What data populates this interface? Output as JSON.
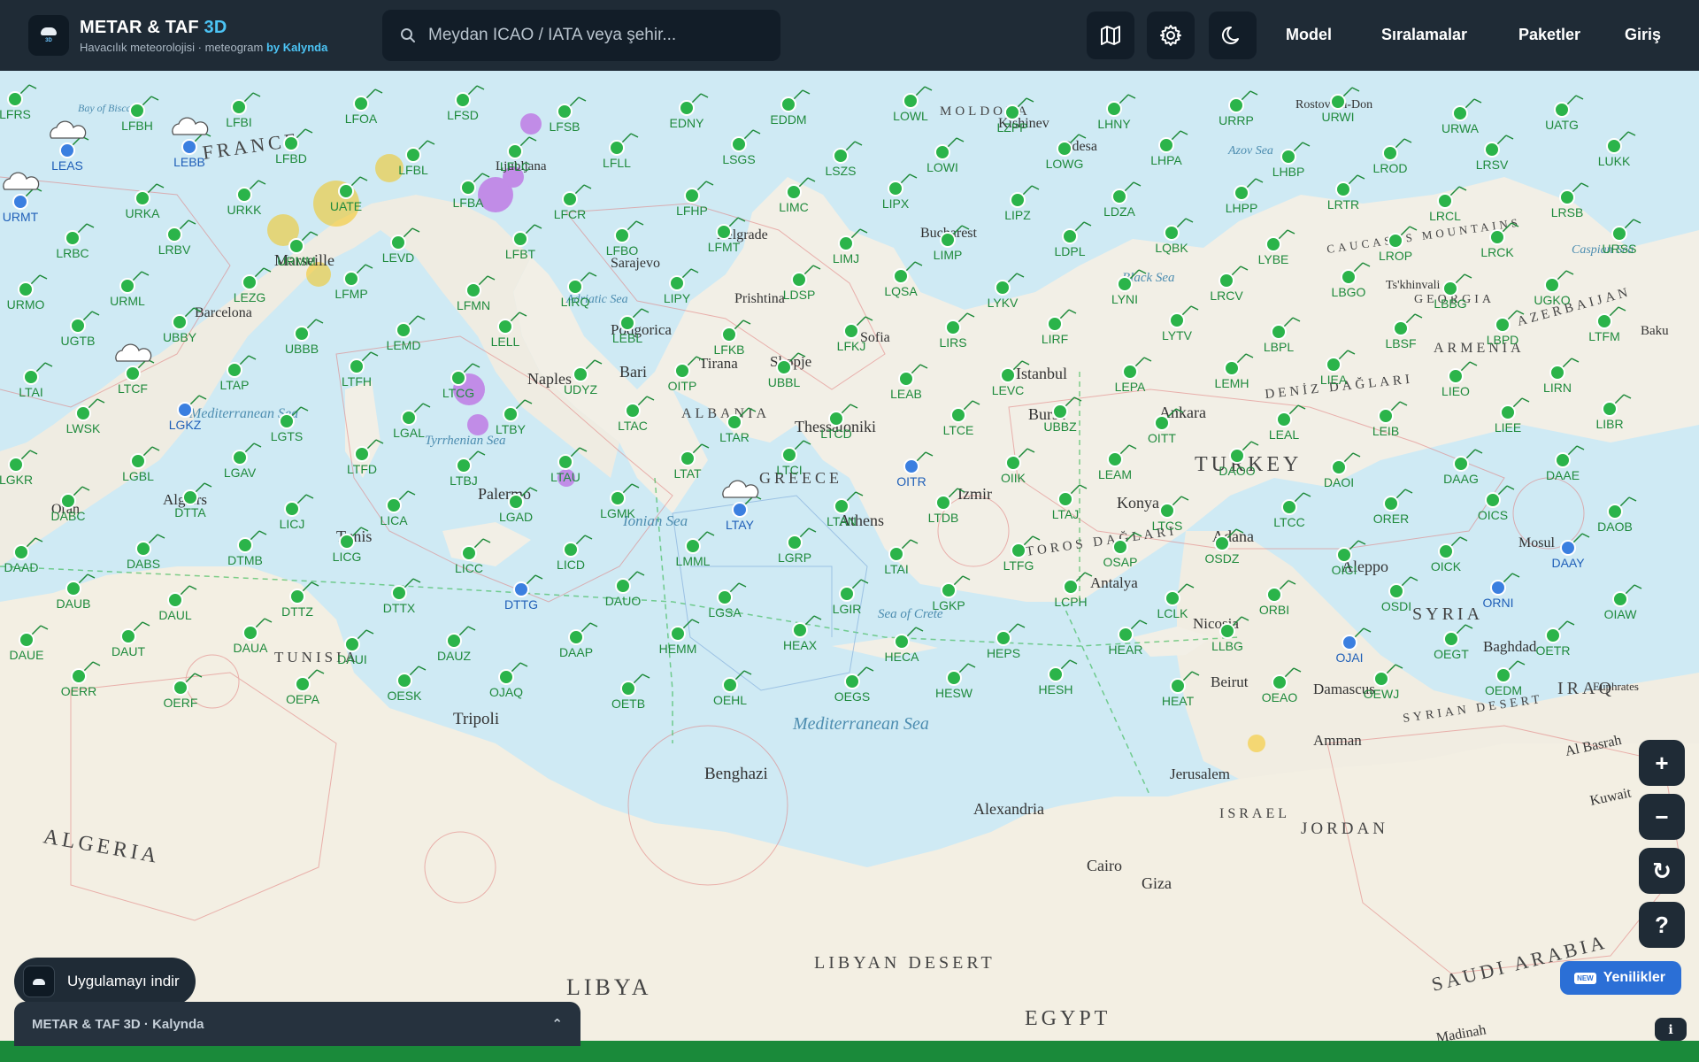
{
  "header": {
    "title_main": "METAR & TAF",
    "title_accent": "3D",
    "subtitle": "Havacılık meteorolojisi · meteogram",
    "subtitle_by": "by Kalynda",
    "logo_text": "3D"
  },
  "search": {
    "placeholder": "Meydan ICAO / IATA veya şehir..."
  },
  "nav": {
    "model": "Model",
    "rankings": "Sıralamalar",
    "packages": "Paketler",
    "login": "Giriş"
  },
  "icons": {
    "layers": "map-icon",
    "settings": "gear-icon",
    "theme": "moon-icon",
    "search": "search-icon"
  },
  "colors": {
    "header_bg": "#1f2b36",
    "accent": "#4cc4f5",
    "station_green": "#2bb44a",
    "station_blue": "#3b7fe0",
    "news_blue": "#2b6fd6",
    "footer_green": "#1a8a3a"
  },
  "map": {
    "places": [
      {
        "name": "FRANCE"
      },
      {
        "name": "Marseille"
      },
      {
        "name": "Barcelona"
      },
      {
        "name": "Ljubljana"
      },
      {
        "name": "Sarajevo"
      },
      {
        "name": "Belgrade"
      },
      {
        "name": "Prishtina"
      },
      {
        "name": "Podgorica"
      },
      {
        "name": "Skopje"
      },
      {
        "name": "Tirana"
      },
      {
        "name": "ALBANIA"
      },
      {
        "name": "Sofia"
      },
      {
        "name": "Bucharest"
      },
      {
        "name": "MOLDOVA"
      },
      {
        "name": "Kishinev"
      },
      {
        "name": "Odesa"
      },
      {
        "name": "Rostov-on-Don"
      },
      {
        "name": "Istanbul"
      },
      {
        "name": "Bursa"
      },
      {
        "name": "Ankara"
      },
      {
        "name": "TURKEY"
      },
      {
        "name": "Izmir"
      },
      {
        "name": "Konya"
      },
      {
        "name": "Adana"
      },
      {
        "name": "Antalya"
      },
      {
        "name": "Aleppo"
      },
      {
        "name": "Mosul"
      },
      {
        "name": "SYRIA"
      },
      {
        "name": "Baghdad"
      },
      {
        "name": "IRAQ"
      },
      {
        "name": "Damascus"
      },
      {
        "name": "Beirut"
      },
      {
        "name": "Nicosia"
      },
      {
        "name": "Amman"
      },
      {
        "name": "Jerusalem"
      },
      {
        "name": "ISRAEL"
      },
      {
        "name": "JORDAN"
      },
      {
        "name": "Cairo"
      },
      {
        "name": "Giza"
      },
      {
        "name": "EGYPT"
      },
      {
        "name": "Alexandria"
      },
      {
        "name": "Benghazi"
      },
      {
        "name": "Tripoli"
      },
      {
        "name": "LIBYA"
      },
      {
        "name": "TUNISIA"
      },
      {
        "name": "Tunis"
      },
      {
        "name": "Algiers"
      },
      {
        "name": "ALGERIA"
      },
      {
        "name": "Oran"
      },
      {
        "name": "Palermo"
      },
      {
        "name": "Naples"
      },
      {
        "name": "Bari"
      },
      {
        "name": "Athens"
      },
      {
        "name": "Thessaloniki"
      },
      {
        "name": "GREECE"
      },
      {
        "name": "Ts'khinvali"
      },
      {
        "name": "GEORGIA"
      },
      {
        "name": "ARMENIA"
      },
      {
        "name": "AZERBAIJAN"
      },
      {
        "name": "Baku"
      },
      {
        "name": "CAUCASUS MOUNTAINS"
      },
      {
        "name": "TOROS DAĞLARI"
      },
      {
        "name": "DENİZ DAĞLARI"
      },
      {
        "name": "SYRIAN DESERT"
      },
      {
        "name": "Al Basrah"
      },
      {
        "name": "Kuwait"
      },
      {
        "name": "SAUDI ARABIA"
      },
      {
        "name": "Madinah"
      },
      {
        "name": "Euphrates"
      },
      {
        "name": "LIBYAN DESERT"
      }
    ],
    "seas": [
      {
        "name": "Mediterranean Sea"
      },
      {
        "name": "Black Sea"
      },
      {
        "name": "Azov Sea"
      },
      {
        "name": "Caspian Sea"
      },
      {
        "name": "Ionian Sea"
      },
      {
        "name": "Tyrrhenian Sea"
      },
      {
        "name": "Adriatic Sea"
      },
      {
        "name": "Sea of Crete"
      },
      {
        "name": "Bay of Biscay"
      },
      {
        "name": "Mediterranean Sea (west)"
      }
    ],
    "stations": [
      "LFRS",
      "LFBH",
      "LFBI",
      "LFOA",
      "LFSD",
      "LFSB",
      "EDNY",
      "EDDM",
      "LOWL",
      "LZPP",
      "LHNY",
      "URRP",
      "URWI",
      "URWA",
      "UATG",
      "LEAS",
      "LEBB",
      "LFBD",
      "LFBL",
      "LFLC",
      "LFLL",
      "LSGS",
      "LSZS",
      "LOWI",
      "LOWG",
      "LHPA",
      "LHBP",
      "LROD",
      "LRSV",
      "LUKK",
      "URMT",
      "URKA",
      "URKK",
      "UATE",
      "LFBA",
      "LFCR",
      "LFHP",
      "LIMC",
      "LIPX",
      "LIPZ",
      "LDZA",
      "LHPP",
      "LRTR",
      "LRCL",
      "LRSB",
      "LRBC",
      "LRBV",
      "URMM",
      "LEVD",
      "LFBT",
      "LFBO",
      "LFMT",
      "LIMJ",
      "LIMP",
      "LDPL",
      "LQBK",
      "LYBE",
      "LROP",
      "LRCK",
      "URSS",
      "URMO",
      "URML",
      "LEZG",
      "LFMP",
      "LFMN",
      "LIRQ",
      "LIPY",
      "LDSP",
      "LQSA",
      "LYKV",
      "LYNI",
      "LRCV",
      "LBGO",
      "LBBG",
      "UGKO",
      "UGTB",
      "UBBY",
      "UBBB",
      "LEMD",
      "LELL",
      "LEBL",
      "LFKB",
      "LFKJ",
      "LIRS",
      "LIRF",
      "LYTV",
      "LBPL",
      "LBSF",
      "LBPD",
      "LTFM",
      "LTAI",
      "LTCF",
      "LTAP",
      "LTFH",
      "LTCG",
      "UDYZ",
      "OITP",
      "UBBL",
      "LEAB",
      "LEVC",
      "LEPA",
      "LEMH",
      "LIEA",
      "LIEO",
      "LIRN",
      "LWSK",
      "LGKZ",
      "LGTS",
      "LGAL",
      "LTBY",
      "LTAC",
      "LTAR",
      "LTCD",
      "LTCE",
      "UBBZ",
      "OITT",
      "LEAL",
      "LEIB",
      "LIEE",
      "LIBR",
      "LGKR",
      "LGBL",
      "LGAV",
      "LTFD",
      "LTBJ",
      "LTAU",
      "LTAT",
      "LTCI",
      "OITR",
      "OIIK",
      "LEAM",
      "DAOO",
      "DAOI",
      "DAAG",
      "DAAE",
      "DABC",
      "DTTA",
      "LICJ",
      "LICA",
      "LGAD",
      "LGMK",
      "LTAY",
      "LTAN",
      "LTDB",
      "LTAJ",
      "LTCS",
      "LTCC",
      "ORER",
      "OICS",
      "DAOB",
      "DAAD",
      "DABS",
      "DTMB",
      "LICG",
      "LICC",
      "LICD",
      "LMML",
      "LGRP",
      "LTAI",
      "LTFG",
      "OSAP",
      "OSDZ",
      "OICI",
      "OICK",
      "DAAY",
      "DAUB",
      "DAUL",
      "DTTZ",
      "DTTX",
      "DTTG",
      "DAUO",
      "LGSA",
      "LGIR",
      "LGKP",
      "LCPH",
      "LCLK",
      "ORBI",
      "OSDI",
      "ORNI",
      "OIAW",
      "DAUE",
      "DAUT",
      "DAUA",
      "DAUI",
      "DAUZ",
      "DAAP",
      "HEMM",
      "HEAX",
      "HECA",
      "HEPS",
      "HEAR",
      "LLBG",
      "OJAI",
      "OEGT",
      "OETR",
      "OERR",
      "OERF",
      "OEPA",
      "OESK",
      "OJAQ",
      "OETB",
      "OEHL",
      "OEGS",
      "HESW",
      "HESH",
      "HEAT",
      "OEAO",
      "OEWJ",
      "OEDM"
    ],
    "clouds": [
      "LEAS",
      "LEBB",
      "URMT",
      "LTAY",
      "LTCF"
    ]
  },
  "controls": {
    "zoom_in": "+",
    "zoom_out": "−",
    "reset": "↻",
    "help": "?",
    "info": "ℹ"
  },
  "news": {
    "badge": "NEW",
    "label": "Yenilikler"
  },
  "app_banner": {
    "label": "Uygulamayı indir"
  },
  "footer": {
    "label": "METAR & TAF 3D · Kalynda",
    "chevron": "⌃"
  }
}
